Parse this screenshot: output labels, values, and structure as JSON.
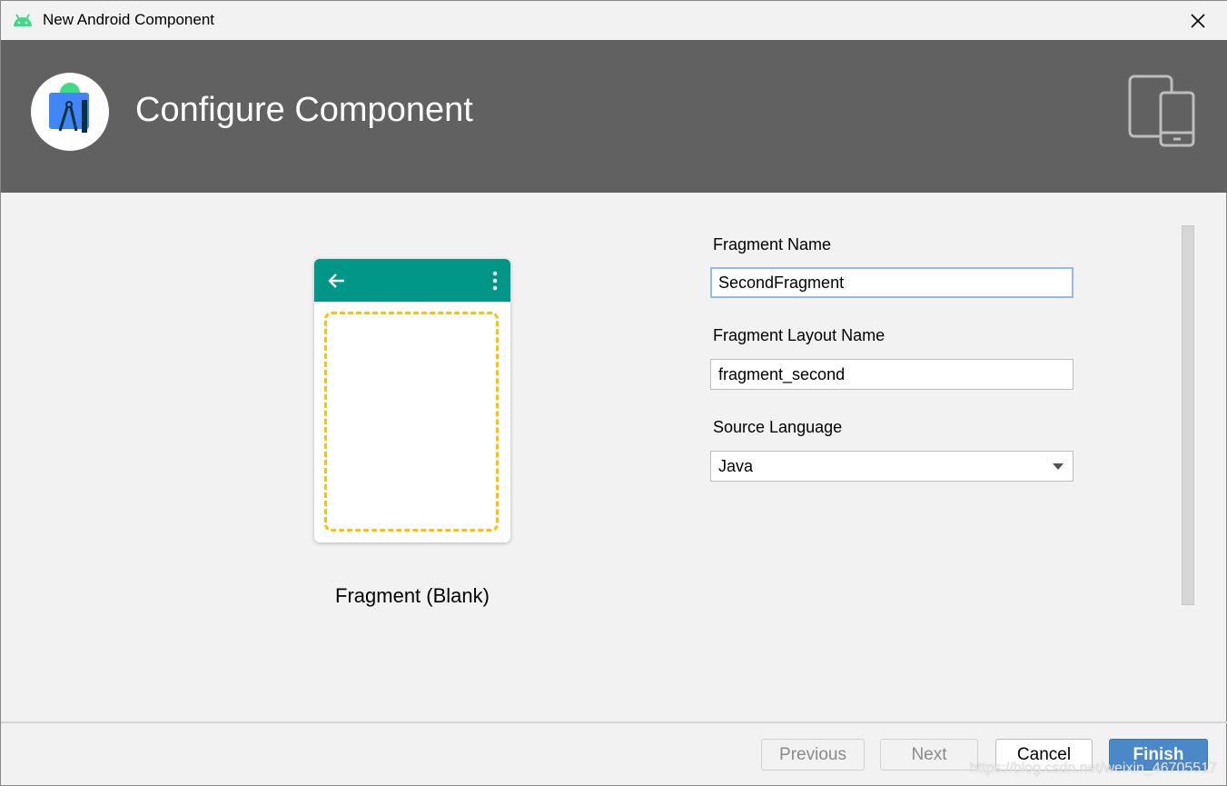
{
  "window": {
    "title": "New Android Component",
    "icon": "android-icon"
  },
  "banner": {
    "title": "Configure Component",
    "logo": "android-studio-logo",
    "device_icon": "devices-icon",
    "background": "#616161"
  },
  "preview": {
    "template_name": "Fragment (Blank)",
    "appbar_color": "#009688",
    "placeholder_color": "#ffc107"
  },
  "form": {
    "fragment_name": {
      "label": "Fragment Name",
      "value": "SecondFragment"
    },
    "layout_name": {
      "label": "Fragment Layout Name",
      "value": "fragment_second"
    },
    "source_language": {
      "label": "Source Language",
      "value": "Java"
    }
  },
  "footer": {
    "previous": "Previous",
    "next": "Next",
    "cancel": "Cancel",
    "finish": "Finish",
    "accent": "#4a88c7"
  },
  "watermark": "https://blog.csdn.net/weixin_46705517"
}
